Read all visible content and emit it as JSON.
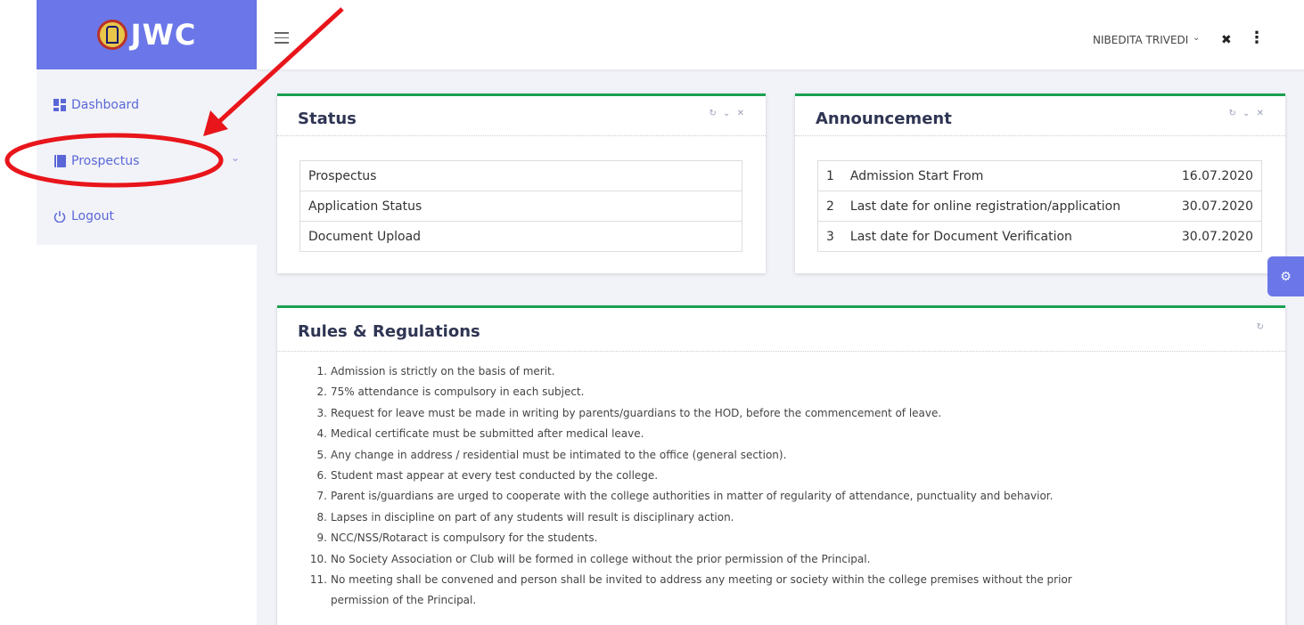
{
  "brand": {
    "logo_text": "JWC"
  },
  "sidebar": {
    "items": [
      {
        "label": "Dashboard",
        "icon": "dashboard-icon"
      },
      {
        "label": "Prospectus",
        "icon": "book-icon"
      },
      {
        "label": "Logout",
        "icon": "power-icon"
      }
    ]
  },
  "topbar": {
    "user_name": "NIBEDITA TRIVEDI"
  },
  "status_card": {
    "title": "Status",
    "rows": [
      "Prospectus",
      "Application Status",
      "Document Upload"
    ]
  },
  "announcement_card": {
    "title": "Announcement",
    "rows": [
      {
        "no": "1",
        "text": "Admission Start From",
        "date": "16.07.2020"
      },
      {
        "no": "2",
        "text": "Last date for online registration/application",
        "date": "30.07.2020"
      },
      {
        "no": "3",
        "text": "Last date for Document Verification",
        "date": "30.07.2020"
      }
    ]
  },
  "rules_card": {
    "title": "Rules & Regulations",
    "rules": [
      {
        "no": "1.",
        "text": "Admission is strictly on the basis of merit."
      },
      {
        "no": "2.",
        "text": "75% attendance is compulsory in each subject."
      },
      {
        "no": "3.",
        "text": "Request for leave must be made in writing by parents/guardians to the HOD, before the commencement of leave."
      },
      {
        "no": "4.",
        "text": "Medical certificate must be submitted after medical leave."
      },
      {
        "no": "5.",
        "text": "Any change in address / residential must be intimated to the office (general section)."
      },
      {
        "no": "6.",
        "text": "Student mast appear at every test conducted by the college."
      },
      {
        "no": "7.",
        "text": "Parent is/guardians are urged to cooperate with the college authorities in matter of regularity of attendance, punctuality and behavior."
      },
      {
        "no": "8.",
        "text": "Lapses in discipline on part of any students will result is disciplinary action."
      },
      {
        "no": "9.",
        "text": "NCC/NSS/Rotaract is compulsory for the students."
      },
      {
        "no": "10.",
        "text": "No Society Association or Club will be formed in college without the prior permission of the Principal."
      },
      {
        "no": "11.",
        "text": "No meeting shall be convened and person shall be invited to address any meeting or society within the college premises without the prior"
      },
      {
        "no": "",
        "text": "permission of the Principal."
      }
    ]
  },
  "colors": {
    "accent": "#6b77e8",
    "card_border": "#1aa051",
    "annotation": "#e8151b"
  }
}
